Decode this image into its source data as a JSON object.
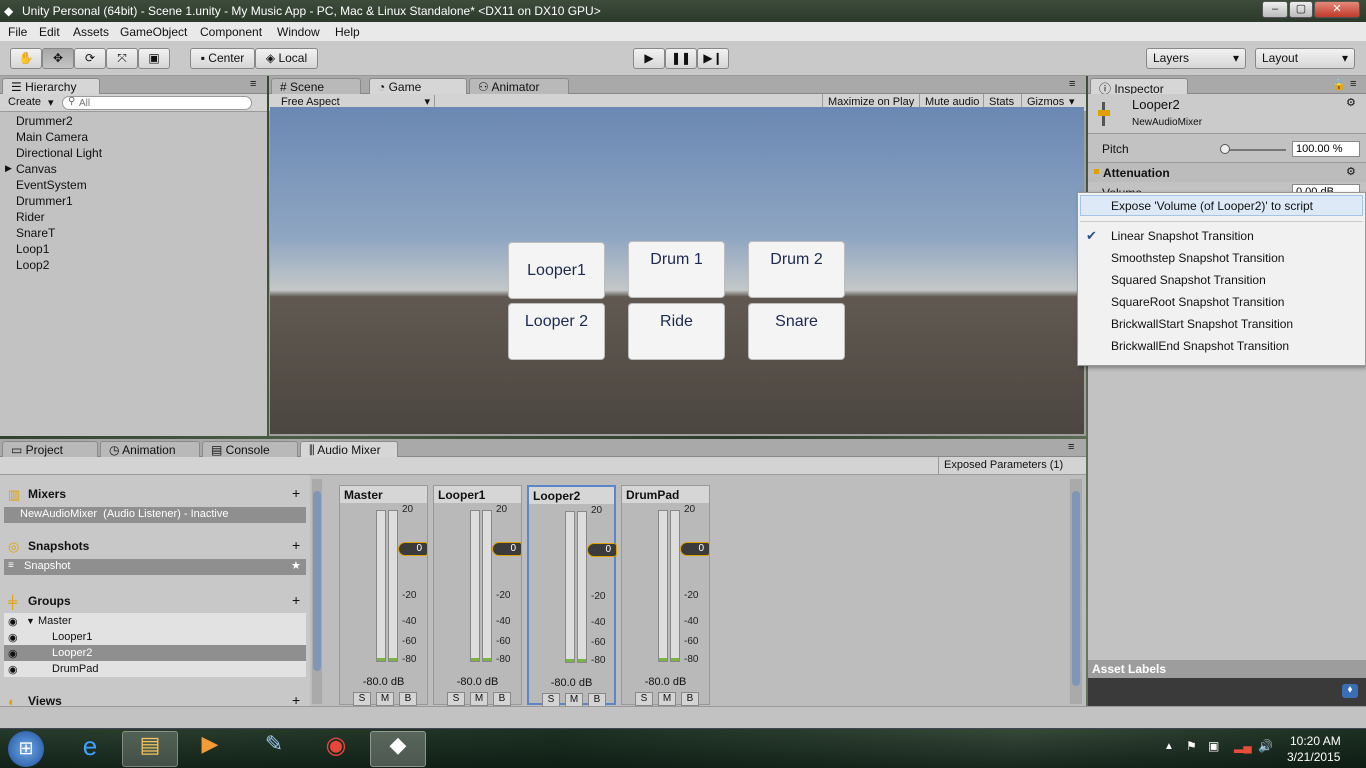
{
  "window": {
    "title": "Unity Personal (64bit) - Scene 1.unity - My Music App - PC, Mac & Linux Standalone* <DX11 on DX10 GPU>"
  },
  "menu": [
    "File",
    "Edit",
    "Assets",
    "GameObject",
    "Component",
    "Window",
    "Help"
  ],
  "toolbar": {
    "pivot": "Center",
    "space": "Local",
    "layers": "Layers",
    "layout": "Layout"
  },
  "hierarchy": {
    "tab": "Hierarchy",
    "create": "Create",
    "search_placeholder": "All",
    "items": [
      "Drummer2",
      "Main Camera",
      "Directional Light",
      "Canvas",
      "EventSystem",
      "Drummer1",
      "Rider",
      "SnareT",
      "Loop1",
      "Loop2"
    ]
  },
  "scene_tabs": {
    "scene": "Scene",
    "game": "Game",
    "animator": "Animator"
  },
  "game_toolbar": {
    "aspect": "Free Aspect",
    "maximize": "Maximize on Play",
    "mute": "Mute audio",
    "stats": "Stats",
    "gizmos": "Gizmos"
  },
  "game_buttons": [
    "Looper1",
    "Drum 1",
    "Drum 2",
    "Looper 2",
    "Ride",
    "Snare"
  ],
  "inspector": {
    "tab": "Inspector",
    "name": "Looper2",
    "subtitle": "NewAudioMixer",
    "pitch_label": "Pitch",
    "pitch_value": "100.00 %",
    "pitch_level": 0.05,
    "attenuation": "Attenuation",
    "volume_label": "Volume",
    "volume_value": "0.00 dB",
    "asset_labels": "Asset Labels"
  },
  "bottom_tabs": {
    "project": "Project",
    "animation": "Animation",
    "console": "Console",
    "mixer": "Audio Mixer"
  },
  "exposed": "Exposed Parameters (1)",
  "mixers": {
    "header": "Mixers",
    "item": "NewAudioMixer",
    "item_detail": "(Audio Listener) - Inactive"
  },
  "snapshots": {
    "header": "Snapshots",
    "item": "Snapshot"
  },
  "groups": {
    "header": "Groups",
    "master": "Master",
    "children": [
      "Looper1",
      "Looper2",
      "DrumPad"
    ]
  },
  "views": {
    "header": "Views"
  },
  "strips": [
    {
      "name": "Master",
      "db": "-80.0 dB",
      "fader": "0"
    },
    {
      "name": "Looper1",
      "db": "-80.0 dB",
      "fader": "0"
    },
    {
      "name": "Looper2",
      "db": "-80.0 dB",
      "fader": "0"
    },
    {
      "name": "DrumPad",
      "db": "-80.0 dB",
      "fader": "0"
    }
  ],
  "meter_ticks": [
    "20",
    "0",
    "-20",
    "-40",
    "-60",
    "-80"
  ],
  "strip_buttons": [
    "S",
    "M",
    "B"
  ],
  "context_menu": {
    "expose": "Expose 'Volume (of Looper2)' to script",
    "items": [
      "Linear Snapshot Transition",
      "Smoothstep Snapshot Transition",
      "Squared Snapshot Transition",
      "SquareRoot Snapshot Transition",
      "BrickwallStart Snapshot Transition",
      "BrickwallEnd Snapshot Transition"
    ],
    "checked": "Linear Snapshot Transition"
  },
  "tray": {
    "time": "10:20 AM",
    "date": "3/21/2015"
  },
  "colors": {
    "accent_selected": "#5b86c8",
    "fader_orange": "#e0a000"
  }
}
